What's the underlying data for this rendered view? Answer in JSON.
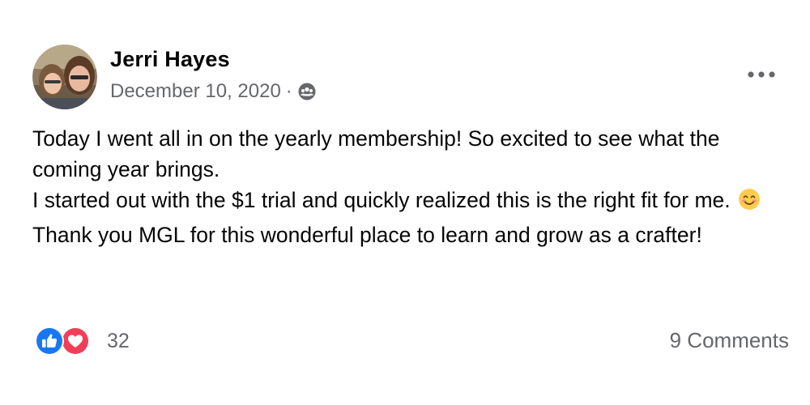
{
  "post": {
    "author": "Jerri Hayes",
    "date": "December 10, 2020",
    "separator": "·",
    "audience_icon": "group-audience-icon",
    "more_icon": "more-options-icon",
    "paragraphs": {
      "p1": "Today I went all in on the yearly membership! So excited to see what the coming year brings.",
      "p2": "I started out with the $1 trial and quickly realized this is the right fit for me.",
      "p3": "Thank you MGL for this wonderful place to learn and grow as a crafter!"
    },
    "emoji": "smiling-face-icon"
  },
  "footer": {
    "reaction_count": "32",
    "reaction_types": [
      "like",
      "love"
    ],
    "comments_label": "9 Comments"
  },
  "colors": {
    "text": "#050505",
    "secondary": "#65676b",
    "like_blue": "#1877f2",
    "love_red": "#f33e58"
  }
}
